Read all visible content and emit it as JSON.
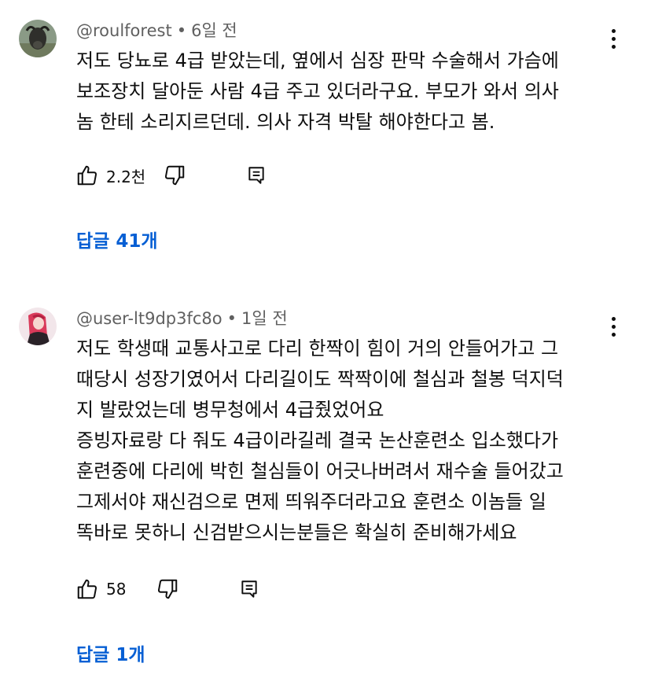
{
  "comments": [
    {
      "author": "@roulforest",
      "time": "6일 전",
      "lines": [
        "저도 당뇨로 4급 받았는데, 옆에서 심장 판막 수술해서 가슴에",
        "보조장치 달아둔 사람 4급 주고 있더라구요. 부모가 와서 의사",
        "놈 한테 소리지르던데. 의사 자격 박탈 해야한다고 봄."
      ],
      "likes": "2.2천",
      "replies": "답글 41개"
    },
    {
      "author": "@user-lt9dp3fc8o",
      "time": "1일 전",
      "lines": [
        "저도 학생때 교통사고로 다리 한짝이 힘이 거의 안들어가고 그",
        "때당시 성장기였어서 다리길이도 짝짝이에 철심과 철봉 덕지덕",
        "지 발랐었는데 병무청에서 4급줬었어요",
        "증빙자료랑 다 줘도 4급이라길레 결국 논산훈련소 입소했다가",
        "훈련중에 다리에 박힌 철심들이 어긋나버려서 재수술 들어갔고",
        "그제서야 재신검으로 면제 띄워주더라고요 훈련소 이놈들 일",
        "똑바로 못하니 신검받으시는분들은 확실히 준비해가세요"
      ],
      "likes": "58",
      "replies": "답글 1개"
    }
  ],
  "colors": {
    "link": "#065fd4",
    "meta": "#606060",
    "text": "#0f0f0f"
  },
  "icons": [
    "kebab-menu-icon",
    "thumbs-up-icon",
    "thumbs-down-icon",
    "reply-icon"
  ]
}
